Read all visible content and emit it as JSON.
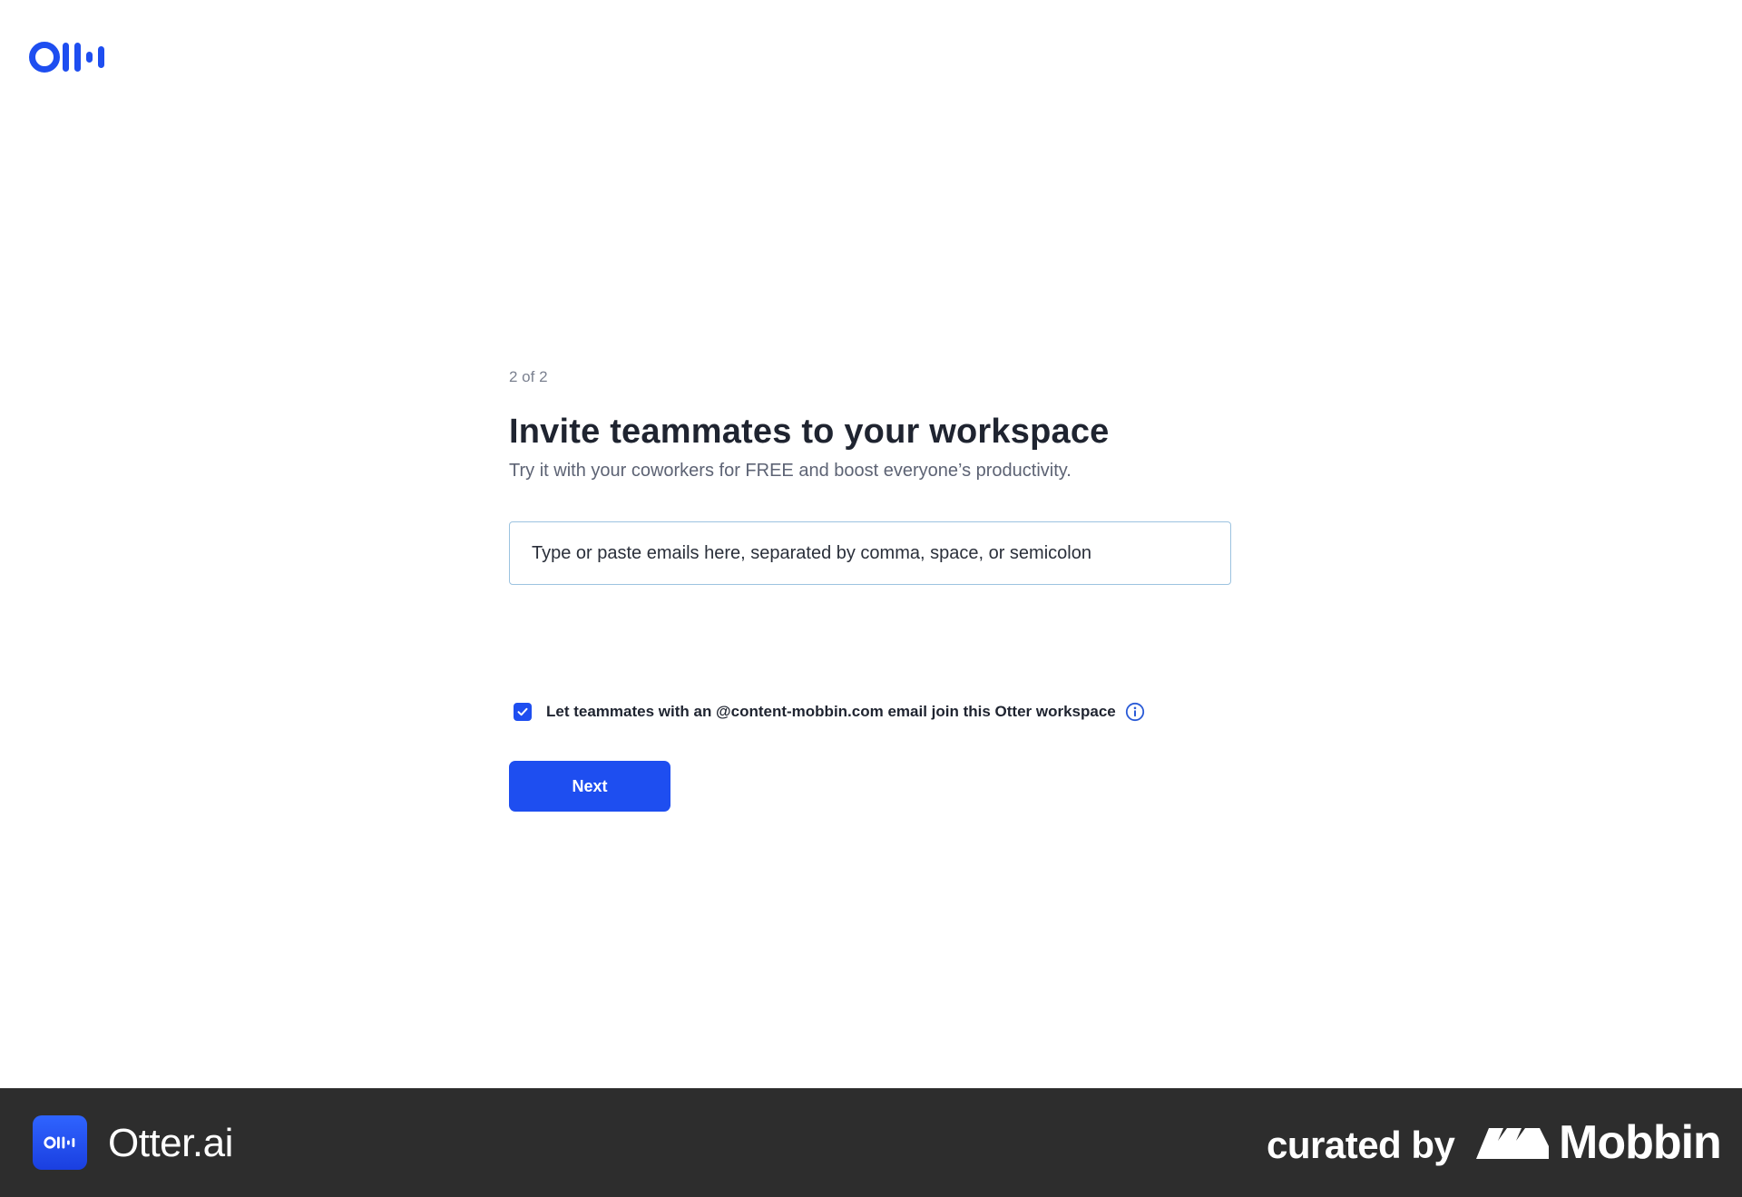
{
  "brand": {
    "logo_icon": "otter-logo-icon",
    "accent_color": "#1e4ef0"
  },
  "onboarding": {
    "step": "2 of 2",
    "title": "Invite teammates to your workspace",
    "subtitle": "Try it with your coworkers for FREE and boost everyone’s productivity.",
    "email_input": {
      "value": "",
      "placeholder": "Type or paste emails here, separated by comma, space, or semicolon"
    },
    "domain_join": {
      "checked": true,
      "label": "Let teammates with an @content-mobbin.com email join this Otter workspace",
      "info_icon": "info-icon"
    },
    "next_label": "Next"
  },
  "footer": {
    "app_name": "Otter.ai",
    "curated_label": "curated by",
    "curator_name": "Mobbin",
    "background_color": "#2d2d2d"
  }
}
